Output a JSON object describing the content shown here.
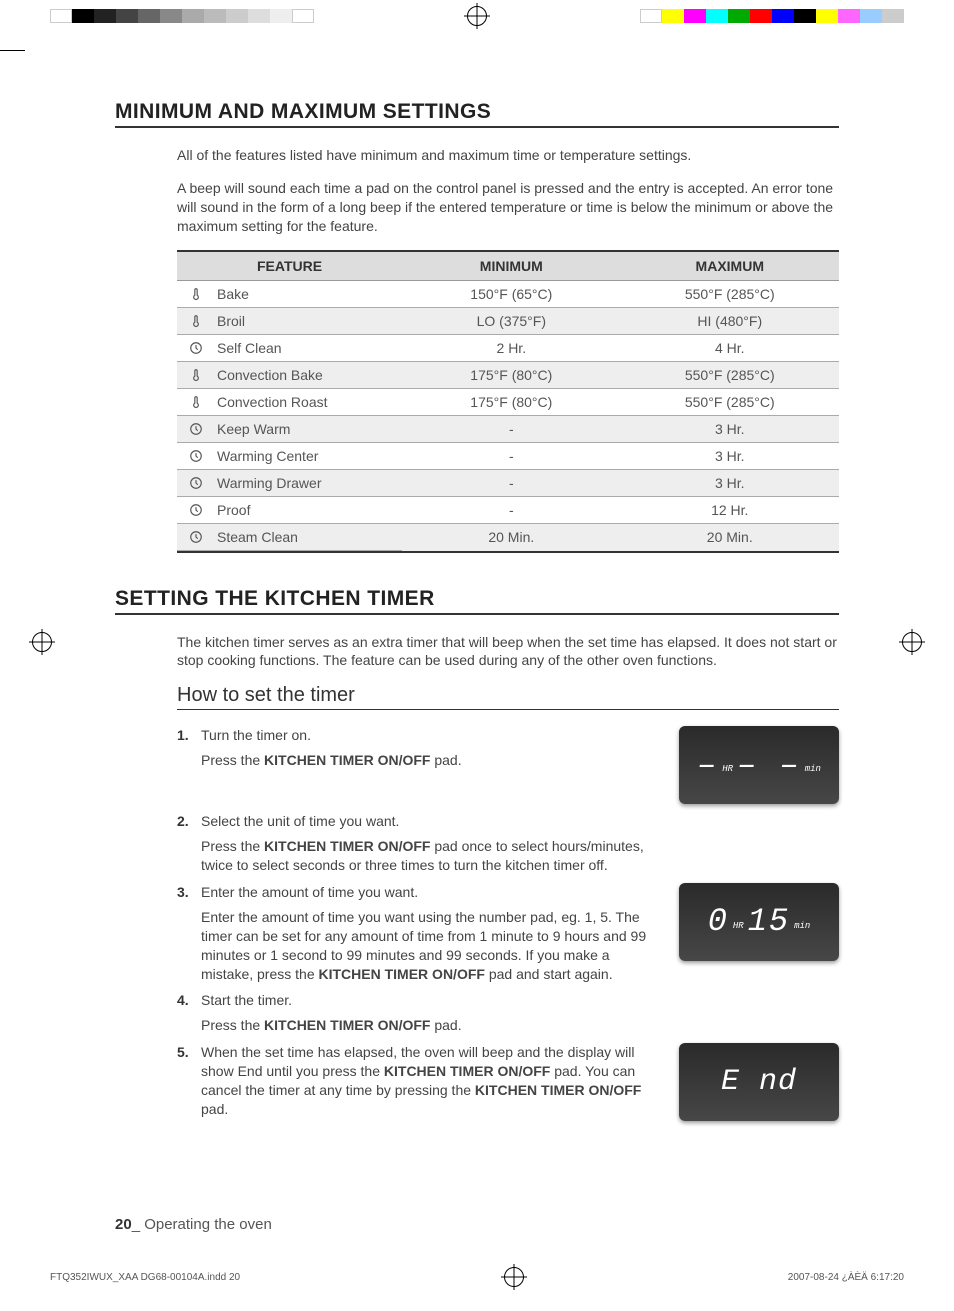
{
  "section1": {
    "title": "MINIMUM AND MAXIMUM SETTINGS",
    "para1": "All of the features listed have minimum and maximum time or temperature settings.",
    "para2": "A beep will sound each time a pad on the control panel is pressed and the entry is accepted. An error tone will sound in the form of a long beep if the entered temperature or time is below the minimum or above the maximum setting for the feature."
  },
  "table": {
    "headers": {
      "c1": "FEATURE",
      "c2": "MINIMUM",
      "c3": "MAXIMUM"
    },
    "rows": [
      {
        "icon": "thermo",
        "feature": "Bake",
        "min": "150°F (65°C)",
        "max": "550°F (285°C)"
      },
      {
        "icon": "thermo",
        "feature": "Broil",
        "min": "LO (375°F)",
        "max": "HI (480°F)"
      },
      {
        "icon": "clock",
        "feature": "Self Clean",
        "min": "2 Hr.",
        "max": "4 Hr."
      },
      {
        "icon": "thermo",
        "feature": "Convection Bake",
        "min": "175°F (80°C)",
        "max": "550°F (285°C)"
      },
      {
        "icon": "thermo",
        "feature": "Convection Roast",
        "min": "175°F (80°C)",
        "max": "550°F (285°C)"
      },
      {
        "icon": "clock",
        "feature": "Keep Warm",
        "min": "-",
        "max": "3 Hr."
      },
      {
        "icon": "clock",
        "feature": "Warming Center",
        "min": "-",
        "max": "3 Hr."
      },
      {
        "icon": "clock",
        "feature": "Warming Drawer",
        "min": "-",
        "max": "3 Hr."
      },
      {
        "icon": "clock",
        "feature": "Proof",
        "min": "-",
        "max": "12 Hr."
      },
      {
        "icon": "clock",
        "feature": "Steam Clean",
        "min": "20 Min.",
        "max": "20 Min."
      }
    ]
  },
  "section2": {
    "title": "SETTING THE KITCHEN TIMER",
    "intro": "The kitchen timer serves as an extra timer that will beep when the set time has elapsed. It does not start or stop cooking functions. The feature can be used during any of the other oven functions.",
    "subheading": "How to set the timer"
  },
  "steps": {
    "s1": {
      "title": "Turn the timer on.",
      "detail_pre": "Press the ",
      "detail_bold": "KITCHEN TIMER ON/OFF",
      "detail_post": " pad."
    },
    "s2": {
      "title": "Select the unit of time you want.",
      "detail_pre": "Press the ",
      "detail_bold": "KITCHEN TIMER ON/OFF",
      "detail_post": " pad once to select hours/minutes, twice to select seconds or three times to turn the kitchen timer off."
    },
    "s3": {
      "title": "Enter the amount of time you want.",
      "detail_pre": "Enter the amount of time you want using the number pad, eg. 1, 5. The timer can be set for any amount of time from 1 minute to 9 hours and 99 minutes or 1 second to 99 minutes and 99 seconds. If you make a mistake, press the ",
      "detail_bold": "KITCHEN TIMER ON/OFF",
      "detail_post": " pad and start again."
    },
    "s4": {
      "title": "Start the timer.",
      "detail_pre": "Press the ",
      "detail_bold": "KITCHEN TIMER ON/OFF",
      "detail_post": " pad."
    },
    "s5": {
      "title_pre": "When the set time has elapsed, the oven will beep and the display will show End until you press the ",
      "title_bold1": "KITCHEN TIMER ON/OFF",
      "title_mid": " pad. You can cancel the timer at any time by pressing the ",
      "title_bold2": "KITCHEN TIMER ON/OFF",
      "title_post": " pad."
    }
  },
  "displays": {
    "d1": {
      "hr": "–",
      "hr_unit": "HR",
      "min": "– –",
      "min_unit": "min"
    },
    "d2": {
      "hr": "0",
      "hr_unit": "HR",
      "min": "15",
      "min_unit": "min"
    },
    "d3": {
      "text": "E nd"
    }
  },
  "footer": {
    "page_num": "20",
    "separator": "_ ",
    "page_label": "Operating the oven"
  },
  "print_footer": {
    "filename": "FTQ352IWUX_XAA DG68-00104A.indd   20",
    "datetime": "2007-08-24   ¿ÀÈÄ 6:17:20"
  }
}
